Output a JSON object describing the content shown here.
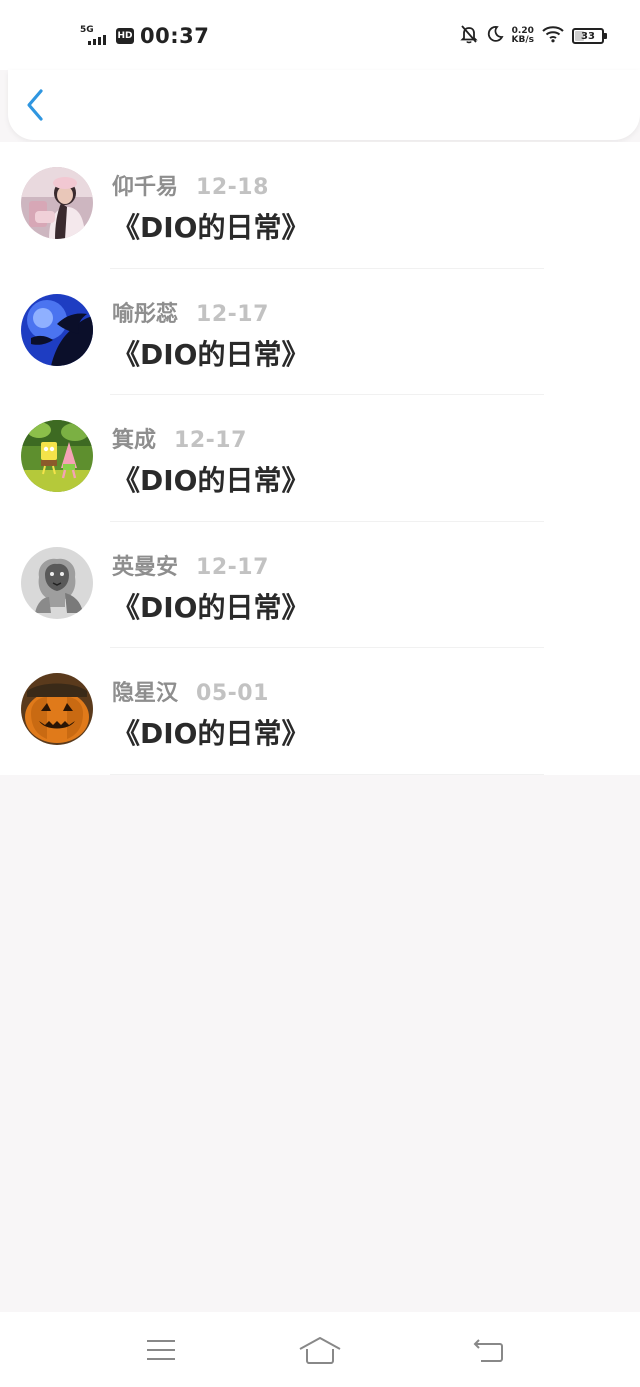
{
  "status_bar": {
    "network": "5G",
    "hd": "HD",
    "time": "00:37",
    "speed_value": "0.20",
    "speed_unit": "KB/s",
    "battery_level": "33",
    "icons": [
      "signal-icon",
      "hd-icon",
      "bell-off-icon",
      "moon-icon",
      "wifi-icon",
      "battery-icon"
    ]
  },
  "header": {
    "back_icon": "chevron-left-icon",
    "accent_color": "#2f96e0"
  },
  "list": [
    {
      "name": "仰千易",
      "date": "12-18",
      "title": "《DIO的日常》",
      "avatar": "girl-photo"
    },
    {
      "name": "喻彤蕊",
      "date": "12-17",
      "title": "《DIO的日常》",
      "avatar": "blue-silhouette"
    },
    {
      "name": "箕成",
      "date": "12-17",
      "title": "《DIO的日常》",
      "avatar": "cartoon-characters"
    },
    {
      "name": "英曼安",
      "date": "12-17",
      "title": "《DIO的日常》",
      "avatar": "lion-sketch"
    },
    {
      "name": "隐星汉",
      "date": "05-01",
      "title": "《DIO的日常》",
      "avatar": "pumpkin"
    }
  ],
  "nav_bar": {
    "icons": [
      "menu-icon",
      "home-icon",
      "back-icon"
    ]
  }
}
